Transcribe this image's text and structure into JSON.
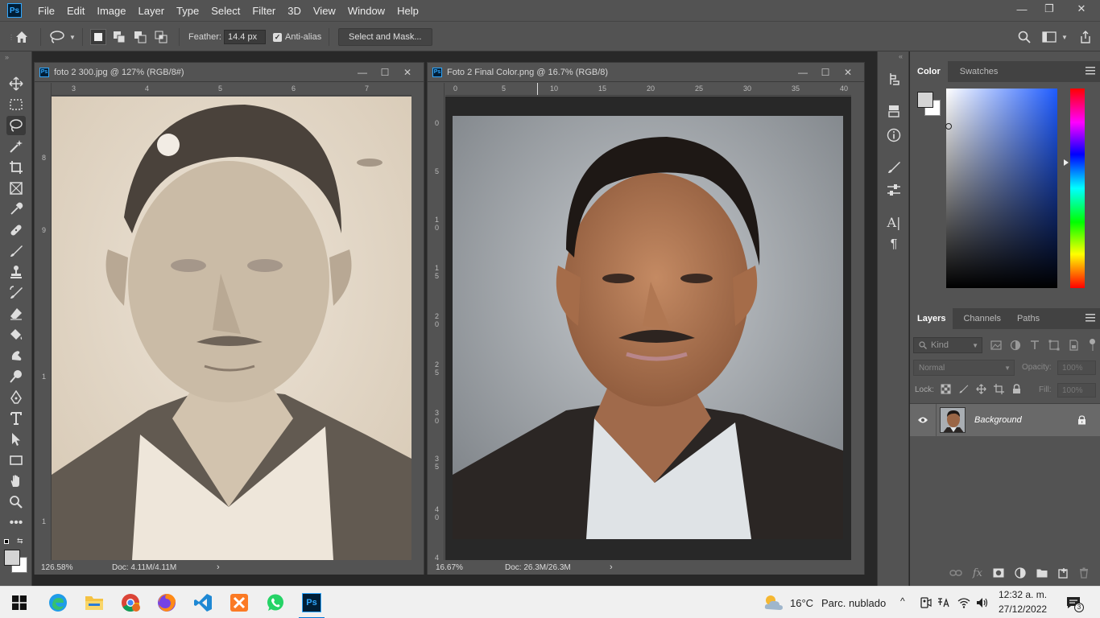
{
  "app": {
    "logo_text": "Ps"
  },
  "menu": [
    "File",
    "Edit",
    "Image",
    "Layer",
    "Type",
    "Select",
    "Filter",
    "3D",
    "View",
    "Window",
    "Help"
  ],
  "window_controls": {
    "minimize": "—",
    "restore": "❐",
    "close": "✕"
  },
  "options_bar": {
    "feather_label": "Feather:",
    "feather_value": "14.4 px",
    "antialias_label": "Anti-alias",
    "antialias_checked": true,
    "select_mask_label": "Select and Mask..."
  },
  "doc1": {
    "title": "foto 2 300.jpg @ 127% (RGB/8#)",
    "zoom": "126.58%",
    "doc_size": "Doc: 4.11M/4.11M",
    "ruler_h": [
      "3",
      "4",
      "5",
      "6",
      "7"
    ],
    "ruler_v": [
      "8",
      "9",
      "1",
      "1"
    ]
  },
  "doc2": {
    "title": "Foto 2 Final Color.png @ 16.7% (RGB/8)",
    "zoom": "16.67%",
    "doc_size": "Doc: 26.3M/26.3M",
    "ruler_h": [
      "0",
      "5",
      "10",
      "15",
      "20",
      "25",
      "30",
      "35",
      "40"
    ],
    "ruler_v": [
      "0",
      "5",
      "1\n0",
      "1\n5",
      "2\n0",
      "2\n5",
      "3\n0",
      "3\n5",
      "4\n0",
      "4"
    ]
  },
  "color_panel": {
    "tabs": [
      "Color",
      "Swatches"
    ],
    "active_tab": "Color",
    "hue_color": "#1e5bff"
  },
  "layers_panel": {
    "tabs": [
      "Layers",
      "Channels",
      "Paths"
    ],
    "active_tab": "Layers",
    "kind_placeholder": "Kind",
    "blend_mode": "Normal",
    "opacity_label": "Opacity:",
    "opacity_value": "100%",
    "lock_label": "Lock:",
    "fill_label": "Fill:",
    "fill_value": "100%",
    "layers": [
      {
        "name": "Background",
        "visible": true,
        "locked": true
      }
    ]
  },
  "taskbar": {
    "weather_temp": "16°C",
    "weather_desc": "Parc. nublado",
    "time": "12:32 a. m.",
    "date": "27/12/2022",
    "notification_count": "3"
  }
}
